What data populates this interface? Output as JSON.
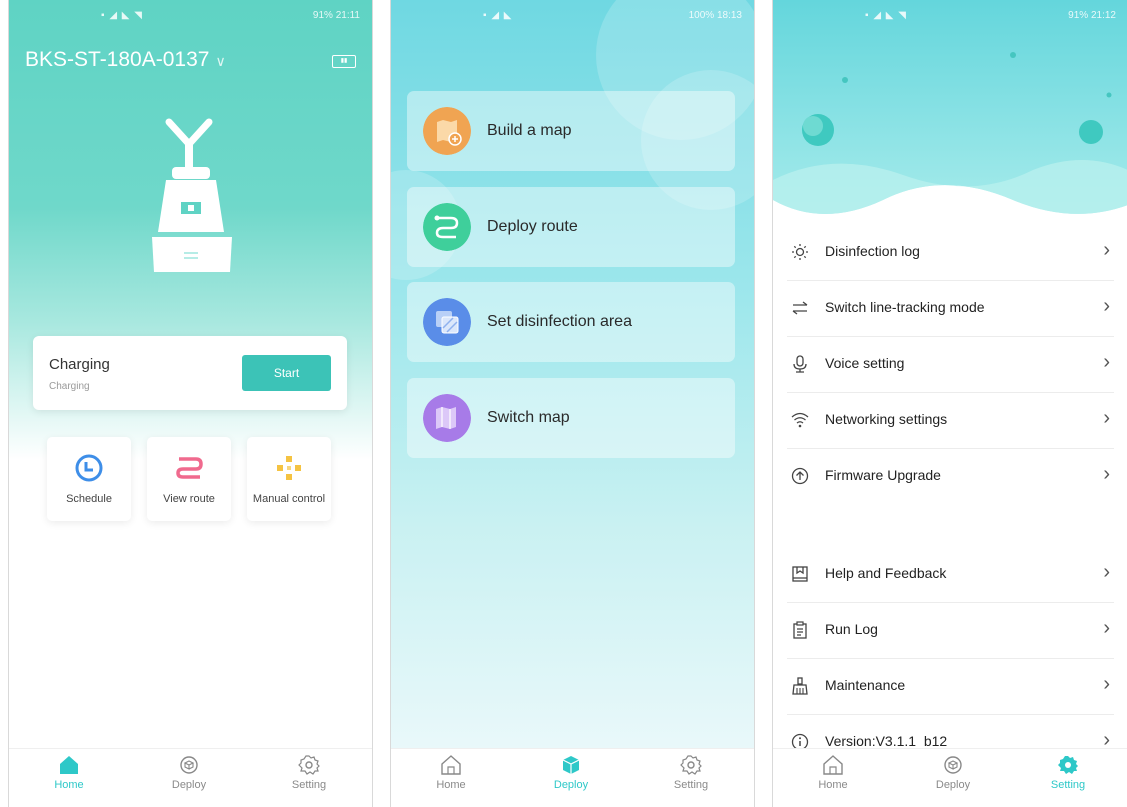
{
  "status_bar": {
    "phone1_time": "21:11",
    "phone1_battery": "91%",
    "phone2_time": "18:13",
    "phone2_battery": "100%",
    "phone3_time": "21:12",
    "phone3_battery": "91%"
  },
  "home": {
    "device_name": "BKS-ST-180A-0137",
    "status_title": "Charging",
    "status_subtitle": "Charging",
    "start_label": "Start",
    "tiles": [
      {
        "label": "Schedule",
        "icon": "clock-icon"
      },
      {
        "label": "View route",
        "icon": "route-icon"
      },
      {
        "label": "Manual control",
        "icon": "dpad-icon"
      }
    ]
  },
  "deploy": {
    "items": [
      {
        "label": "Build a map",
        "icon": "map-add-icon",
        "color": "#f0a452"
      },
      {
        "label": "Deploy route",
        "icon": "route-icon",
        "color": "#3fcf9b"
      },
      {
        "label": "Set disinfection area",
        "icon": "area-icon",
        "color": "#5a8de8"
      },
      {
        "label": "Switch map",
        "icon": "map-switch-icon",
        "color": "#a77be8"
      }
    ]
  },
  "settings": {
    "items": [
      {
        "label": "Disinfection log",
        "icon": "sun-icon"
      },
      {
        "label": "Switch line-tracking mode",
        "icon": "swap-icon"
      },
      {
        "label": "Voice setting",
        "icon": "microphone-icon"
      },
      {
        "label": "Networking settings",
        "icon": "wifi-icon"
      },
      {
        "label": "Firmware Upgrade",
        "icon": "upload-icon"
      },
      {
        "label": "Help and Feedback",
        "icon": "book-icon"
      },
      {
        "label": "Run Log",
        "icon": "clipboard-icon"
      },
      {
        "label": "Maintenance",
        "icon": "broom-icon"
      },
      {
        "label": "Version:V3.1.1_b12",
        "icon": "info-icon"
      }
    ]
  },
  "tabs": {
    "home": "Home",
    "deploy": "Deploy",
    "setting": "Setting"
  },
  "colors": {
    "accent": "#2ec8c8",
    "start_button": "#3cc3b7"
  }
}
